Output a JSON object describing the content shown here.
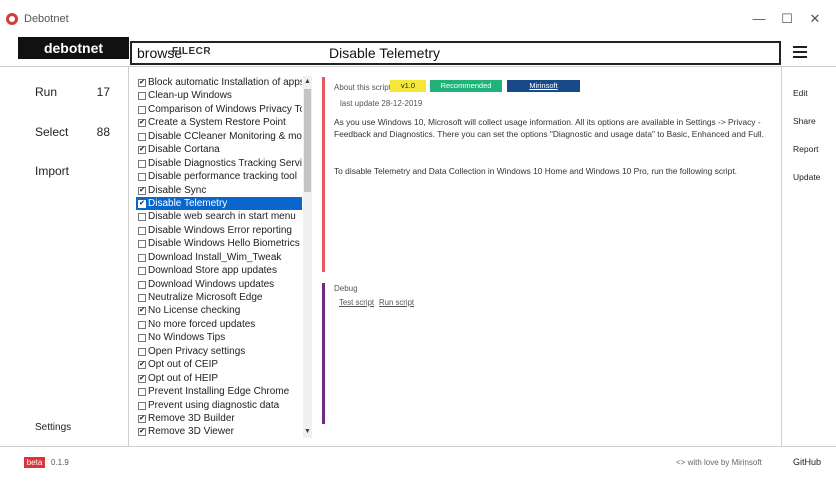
{
  "window": {
    "title": "Debotnet",
    "minimize_glyph": "—",
    "maximize_glyph": "☐",
    "close_glyph": "✕"
  },
  "header": {
    "brand": "debotnet",
    "browse_label": "browse",
    "watermark": "FILECR",
    "title": "Disable Telemetry"
  },
  "nav": {
    "run_label": "Run",
    "run_count": "17",
    "select_label": "Select",
    "select_count": "88",
    "import_label": "Import",
    "settings_label": "Settings"
  },
  "scripts": [
    {
      "label": "Block automatic Installation of apps",
      "checked": true
    },
    {
      "label": "Clean-up Windows",
      "checked": false
    },
    {
      "label": "Comparison of Windows Privacy Tools",
      "checked": false
    },
    {
      "label": "Create a System Restore Point",
      "checked": true
    },
    {
      "label": "Disable CCleaner Monitoring & more",
      "checked": false
    },
    {
      "label": "Disable Cortana",
      "checked": true
    },
    {
      "label": "Disable Diagnostics Tracking Service",
      "checked": false
    },
    {
      "label": "Disable performance tracking tool",
      "checked": false
    },
    {
      "label": "Disable Sync",
      "checked": true
    },
    {
      "label": "Disable Telemetry",
      "checked": true,
      "selected": true
    },
    {
      "label": "Disable web search in start menu",
      "checked": false
    },
    {
      "label": "Disable Windows Error reporting",
      "checked": false
    },
    {
      "label": "Disable Windows Hello Biometrics",
      "checked": false
    },
    {
      "label": "Download Install_Wim_Tweak",
      "checked": false
    },
    {
      "label": "Download Store app updates",
      "checked": false
    },
    {
      "label": "Download Windows updates",
      "checked": false
    },
    {
      "label": "Neutralize Microsoft Edge",
      "checked": false
    },
    {
      "label": "No License checking",
      "checked": true
    },
    {
      "label": "No more forced updates",
      "checked": false
    },
    {
      "label": "No Windows Tips",
      "checked": false
    },
    {
      "label": "Open Privacy settings",
      "checked": false
    },
    {
      "label": "Opt out of CEIP",
      "checked": true
    },
    {
      "label": "Opt out of HEIP",
      "checked": true
    },
    {
      "label": "Prevent Installing Edge Chrome",
      "checked": false
    },
    {
      "label": "Prevent using diagnostic data",
      "checked": false
    },
    {
      "label": "Remove 3D Builder",
      "checked": true
    },
    {
      "label": "Remove 3D Viewer",
      "checked": true
    }
  ],
  "about": {
    "label": "About this script",
    "version": "v1.0",
    "recommended": "Recommended",
    "author": "Mirinsoft",
    "last_update": "last update 28-12-2019",
    "description": "As you use Windows 10, Microsoft will collect usage information. All its options are available in Settings -> Privacy - Feedback and Diagnostics. There you can set the options \"Diagnostic and usage data\" to Basic, Enhanced and Full.",
    "instruction": "To disable Telemetry and Data Collection in Windows 10 Home and Windows 10 Pro, run the following script."
  },
  "debug": {
    "label": "Debug",
    "test_link": "Test script",
    "run_link": "Run script"
  },
  "right_menu": {
    "edit": "Edit",
    "share": "Share",
    "report": "Report",
    "update": "Update"
  },
  "footer": {
    "beta": "beta",
    "version": "0.1.9",
    "love": "<> with love by Mirinsoft",
    "github": "GitHub"
  },
  "colors": {
    "about_accent": "#e05a60",
    "debug_accent": "#6b2b87",
    "selection": "#0a66cc",
    "badge_version": "#f5e73a",
    "badge_recommended": "#1fb37a",
    "badge_author": "#174a87",
    "beta": "#d9353b"
  }
}
